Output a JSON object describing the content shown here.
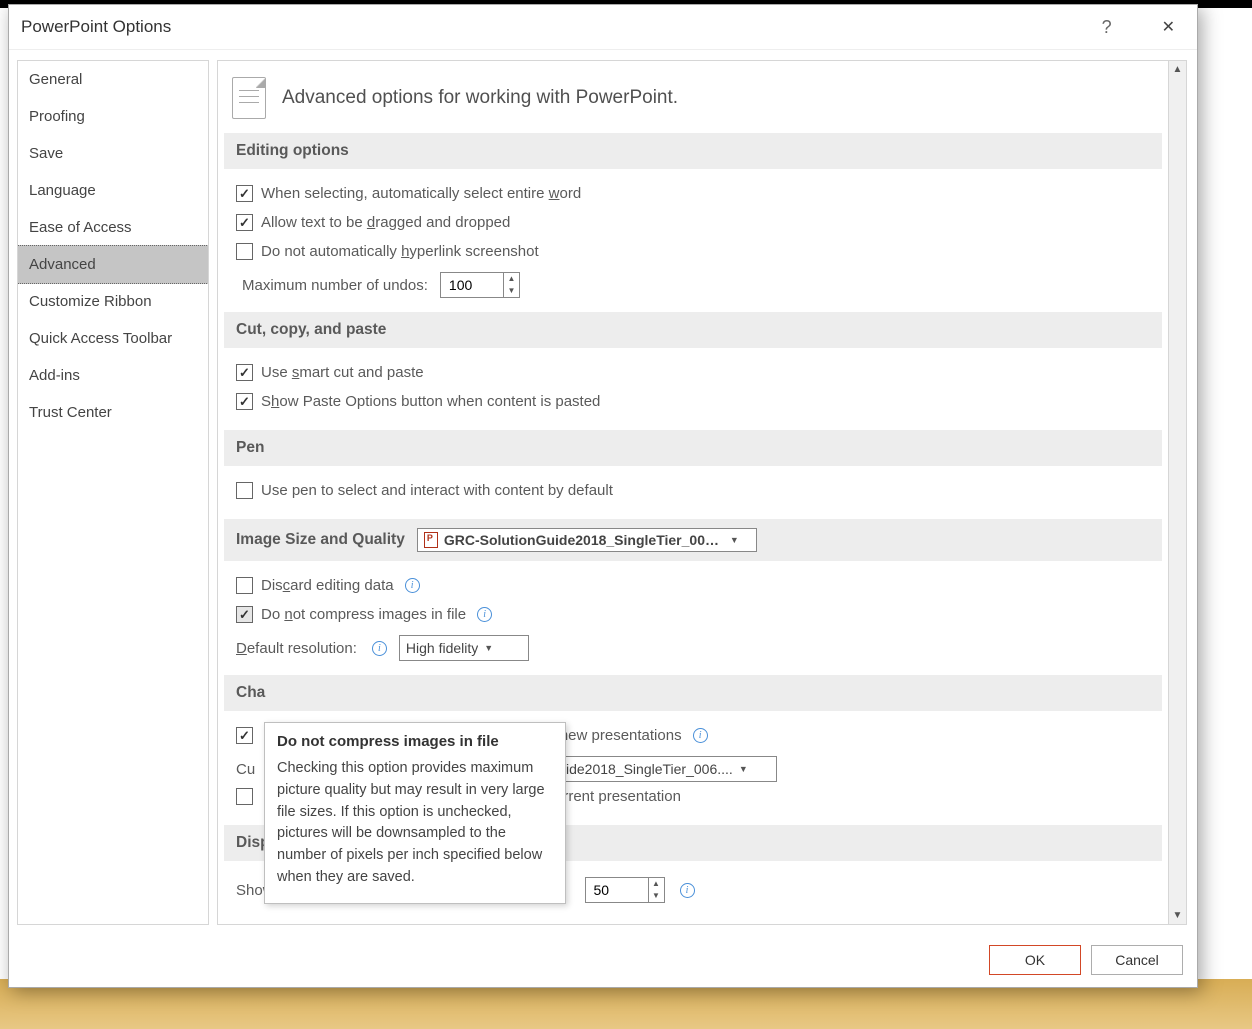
{
  "window": {
    "title": "PowerPoint Options",
    "help": "?",
    "close": "✕"
  },
  "sidebar": {
    "items": [
      {
        "label": "General"
      },
      {
        "label": "Proofing"
      },
      {
        "label": "Save"
      },
      {
        "label": "Language"
      },
      {
        "label": "Ease of Access"
      },
      {
        "label": "Advanced",
        "selected": true
      },
      {
        "label": "Customize Ribbon"
      },
      {
        "label": "Quick Access Toolbar"
      },
      {
        "label": "Add-ins"
      },
      {
        "label": "Trust Center"
      }
    ]
  },
  "header": {
    "title": "Advanced options for working with PowerPoint."
  },
  "sections": {
    "editing": {
      "title": "Editing options",
      "items": {
        "select_word": {
          "label": "When selecting, automatically select entire word",
          "checked": true,
          "accel": "w"
        },
        "drag_drop": {
          "label": "Allow text to be dragged and dropped",
          "checked": true,
          "accel": "d"
        },
        "hyperlink": {
          "label": "Do not automatically hyperlink screenshot",
          "checked": false,
          "accel": "h"
        },
        "undo_label": "Maximum number of undos:",
        "undo_value": "100"
      }
    },
    "cutcopy": {
      "title": "Cut, copy, and paste",
      "items": {
        "smart": {
          "label": "Use smart cut and paste",
          "checked": true,
          "accel": "s"
        },
        "show_opts": {
          "label": "Show Paste Options button when content is pasted",
          "checked": true,
          "accel": "h"
        }
      }
    },
    "pen": {
      "title": "Pen",
      "items": {
        "pen_select": {
          "label": "Use pen to select and interact with content by default",
          "checked": false
        }
      }
    },
    "image": {
      "title": "Image Size and Quality",
      "file": "GRC-SolutionGuide2018_SingleTier_006....",
      "items": {
        "discard": {
          "label": "Discard editing data",
          "checked": false,
          "accel": "c"
        },
        "no_compress": {
          "label": "Do not compress images in file",
          "checked": true,
          "accel": "n"
        },
        "res_label": "Default resolution:",
        "res_value": "High fidelity"
      }
    },
    "chart": {
      "title": "Cha",
      "items": {
        "properties": {
          "label_suffix": "ll new presentations",
          "checked": true
        },
        "current_prefix": "Cu",
        "current_file": "uide2018_SingleTier_006....",
        "datapoint": {
          "label_suffix": "urrent presentation",
          "checked": false
        }
      }
    },
    "display": {
      "title": "Disp",
      "recent_label": "Show this number of Recent Presentations:",
      "recent_value": "50"
    }
  },
  "tooltip": {
    "title": "Do not compress images in file",
    "body": "Checking this option provides maximum picture quality but may result in very large file sizes. If this option is unchecked, pictures will be downsampled to the number of pixels per inch specified below when they are saved."
  },
  "footer": {
    "ok": "OK",
    "cancel": "Cancel"
  }
}
